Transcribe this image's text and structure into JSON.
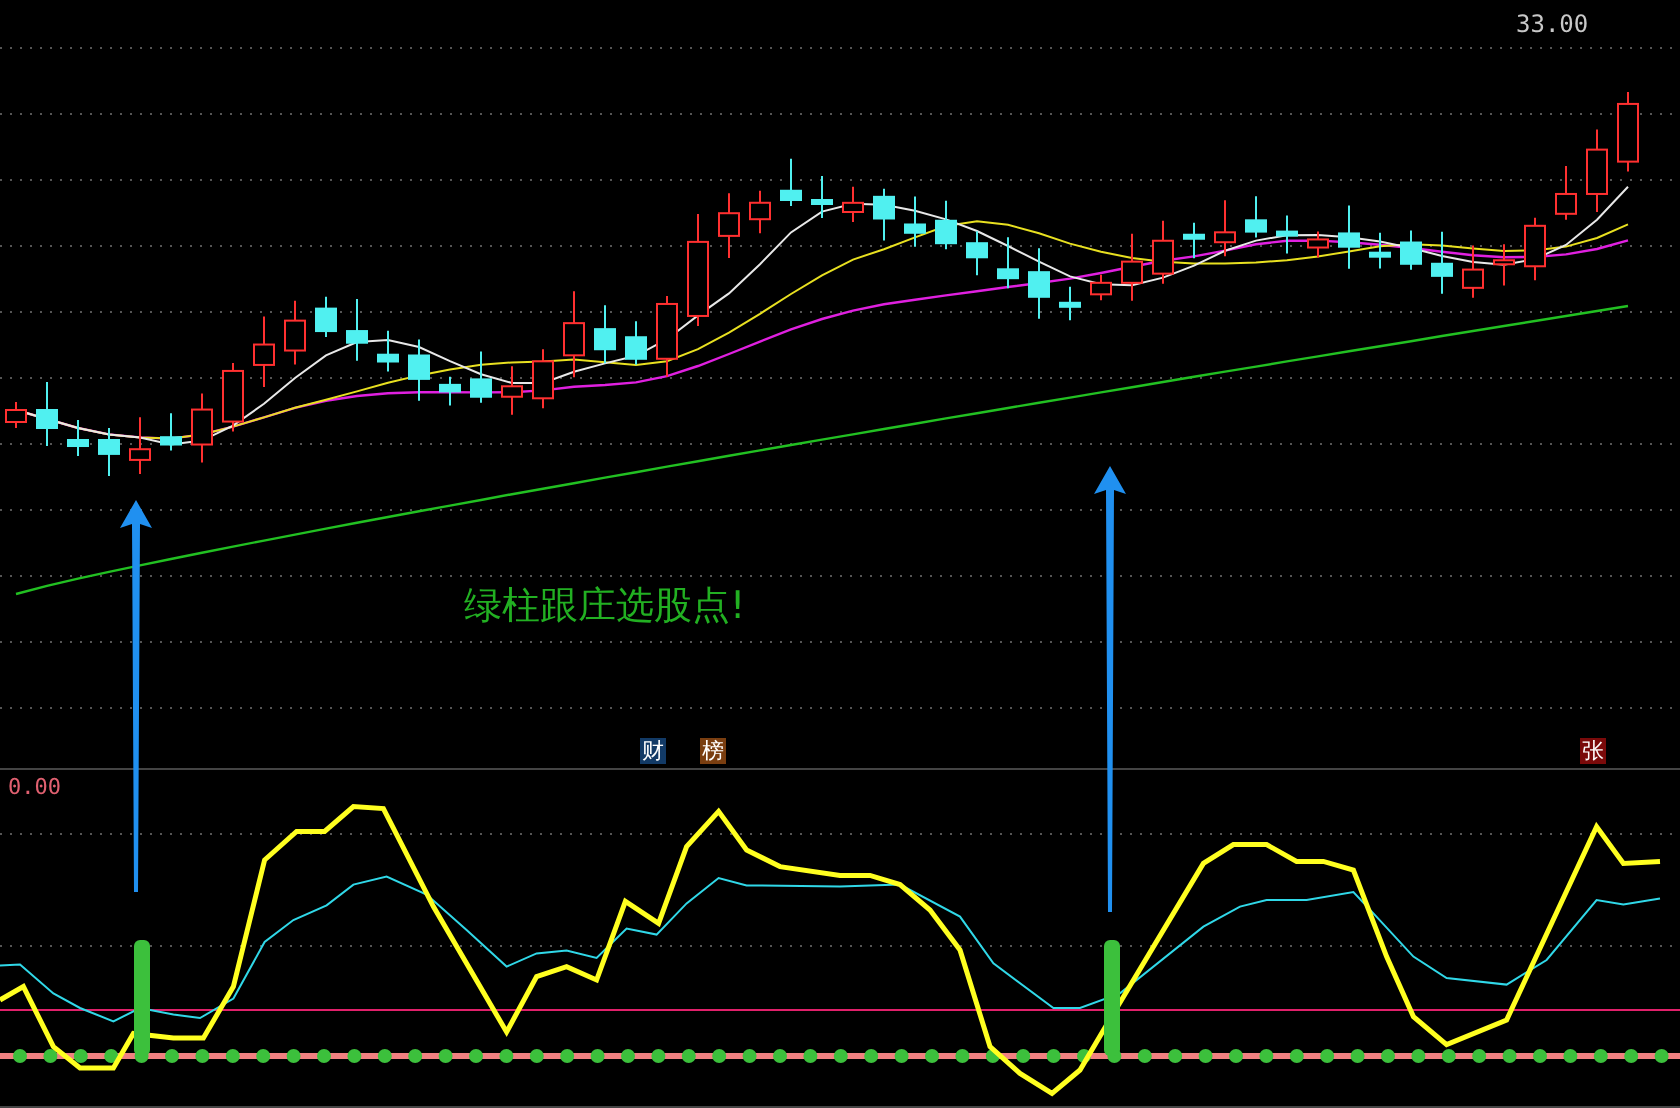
{
  "price_panel": {
    "high_label": "33.00",
    "annotation": "绿柱跟庄选股点!"
  },
  "markers": [
    {
      "label": "财",
      "color": "#123a66"
    },
    {
      "label": "榜",
      "color": "#7a3e10"
    },
    {
      "label": "张",
      "color": "#7a0a0a"
    }
  ],
  "indicator_panel": {
    "zero_label": "0.00"
  }
}
